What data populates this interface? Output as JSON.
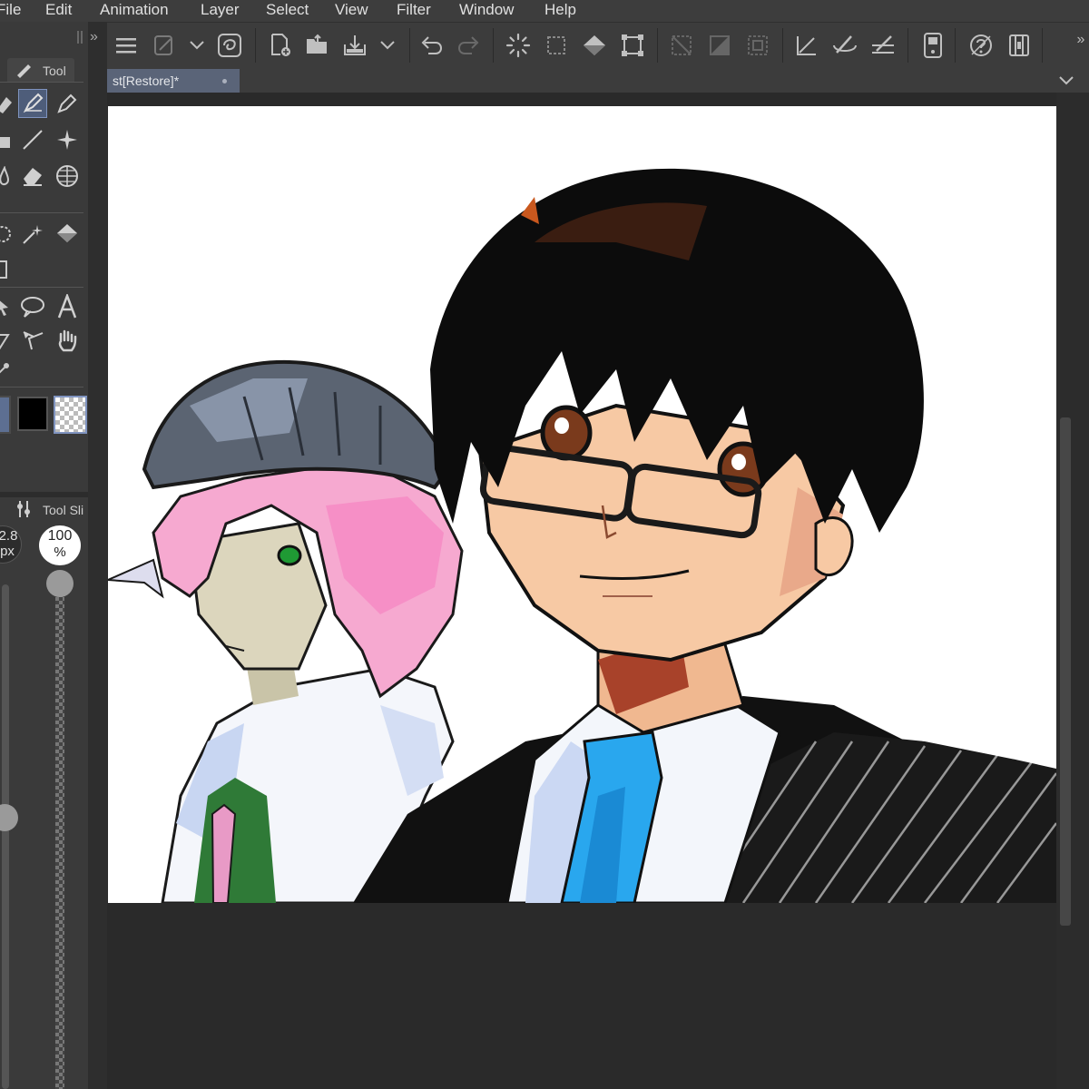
{
  "menu": {
    "items": [
      "File",
      "Edit",
      "Animation",
      "Layer",
      "Select",
      "View",
      "Filter",
      "Window",
      "Help"
    ]
  },
  "left_panel": {
    "tool_tab_label": "Tool",
    "tool_slider_tab_label": "Tool Sli",
    "brush_size": "2.8",
    "brush_size_unit": "px",
    "opacity": "100",
    "opacity_unit": "%"
  },
  "document": {
    "tab_title": "st[Restore]*"
  },
  "colors": {
    "menu_bg": "#3d3d3d",
    "toolbar_bg": "#3c3c3c",
    "panel_bg": "#3a3a3a",
    "canvas_bg": "#2a2a2a",
    "active_tab": "#5a6478",
    "accent": "#6f86b4"
  }
}
